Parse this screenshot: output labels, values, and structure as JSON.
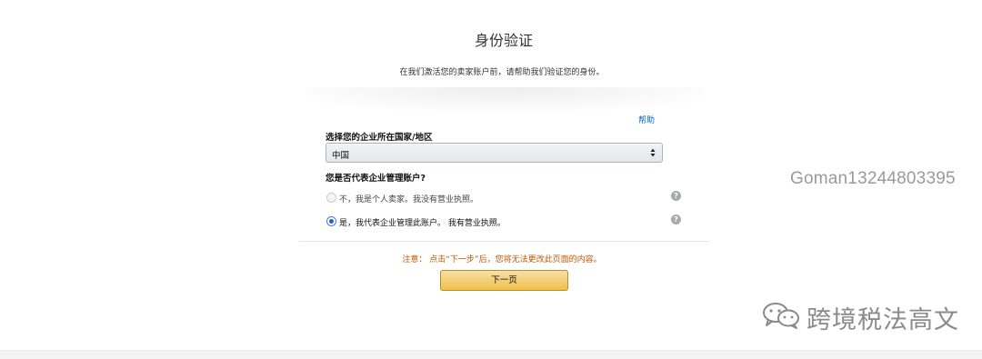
{
  "header": {
    "title": "身份验证",
    "intro": "在我们激活您的卖家账户前，请帮助我们验证您的身份。"
  },
  "form": {
    "help_link": "帮助",
    "country_label": "选择您的企业所在国家/地区",
    "country_value": "中国",
    "business_question": "您是否代表企业管理账户?",
    "options": [
      {
        "label": "不，我是个人卖家。我没有营业执照。",
        "selected": false
      },
      {
        "label": "是，我代表企业管理此账户。 我有营业执照。",
        "selected": true
      }
    ],
    "help_icon_text": "?"
  },
  "footer": {
    "notice": "注意： 点击“下一步”后，您将无法更改此页面的内容。",
    "next_button": "下一页"
  },
  "watermark": {
    "phone": "Goman13244803395",
    "name": "跨境税法高文",
    "logo_icon": "wechat-icon"
  },
  "colors": {
    "link": "#0066c0",
    "notice": "#c45500",
    "button": "#f0c14b",
    "radio_selected": "#1a66d6"
  }
}
